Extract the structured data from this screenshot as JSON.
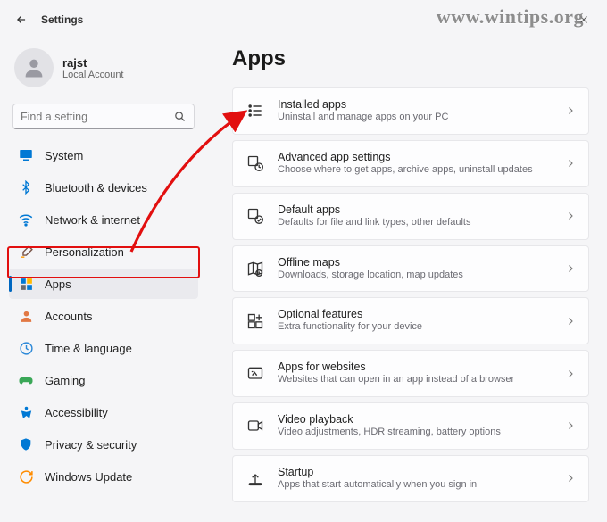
{
  "window": {
    "title": "Settings"
  },
  "user": {
    "name": "rajst",
    "sub": "Local Account"
  },
  "search": {
    "placeholder": "Find a setting"
  },
  "sidebar": {
    "items": [
      {
        "label": "System"
      },
      {
        "label": "Bluetooth & devices"
      },
      {
        "label": "Network & internet"
      },
      {
        "label": "Personalization"
      },
      {
        "label": "Apps"
      },
      {
        "label": "Accounts"
      },
      {
        "label": "Time & language"
      },
      {
        "label": "Gaming"
      },
      {
        "label": "Accessibility"
      },
      {
        "label": "Privacy & security"
      },
      {
        "label": "Windows Update"
      }
    ]
  },
  "page": {
    "title": "Apps"
  },
  "cards": [
    {
      "title": "Installed apps",
      "sub": "Uninstall and manage apps on your PC"
    },
    {
      "title": "Advanced app settings",
      "sub": "Choose where to get apps, archive apps, uninstall updates"
    },
    {
      "title": "Default apps",
      "sub": "Defaults for file and link types, other defaults"
    },
    {
      "title": "Offline maps",
      "sub": "Downloads, storage location, map updates"
    },
    {
      "title": "Optional features",
      "sub": "Extra functionality for your device"
    },
    {
      "title": "Apps for websites",
      "sub": "Websites that can open in an app instead of a browser"
    },
    {
      "title": "Video playback",
      "sub": "Video adjustments, HDR streaming, battery options"
    },
    {
      "title": "Startup",
      "sub": "Apps that start automatically when you sign in"
    }
  ],
  "watermark": "www.wintips.org"
}
